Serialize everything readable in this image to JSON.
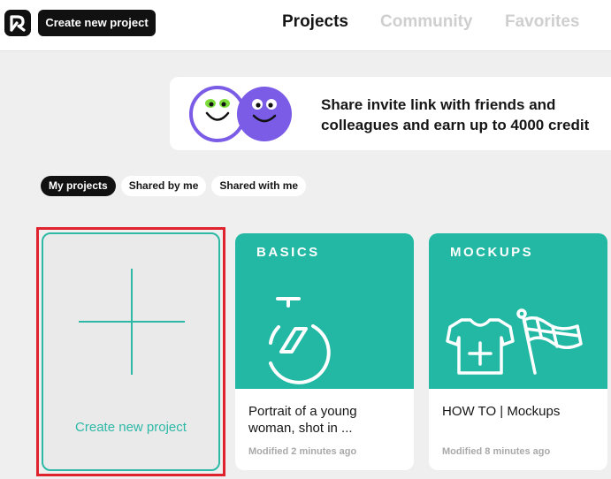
{
  "header": {
    "logo_icon": "brand-logo-icon",
    "create_button_label": "Create new project",
    "tabs": [
      "Projects",
      "Community",
      "Favorites"
    ],
    "active_tab": "Projects"
  },
  "banner": {
    "line1": "Share invite link with friends and",
    "line2": "colleagues and earn up to 4000 credit"
  },
  "filters": {
    "chips": [
      "My projects",
      "Shared by me",
      "Shared with me"
    ],
    "active": "My projects"
  },
  "new_project_card": {
    "label": "Create new project",
    "icon": "plus-icon"
  },
  "projects": [
    {
      "category": "BASICS",
      "title": "Portrait of a young woman, shot in ...",
      "modified": "Modified 2 minutes ago",
      "icon": "stopwatch-icon"
    },
    {
      "category": "MOCKUPS",
      "title": "HOW TO | Mockups",
      "modified": "Modified 8 minutes ago",
      "icon": "tshirt-flag-icon"
    }
  ],
  "colors": {
    "accent": "#22b8a4",
    "highlight": "#e0212e",
    "dark": "#111111",
    "banner_purple": "#7b5ce6"
  }
}
